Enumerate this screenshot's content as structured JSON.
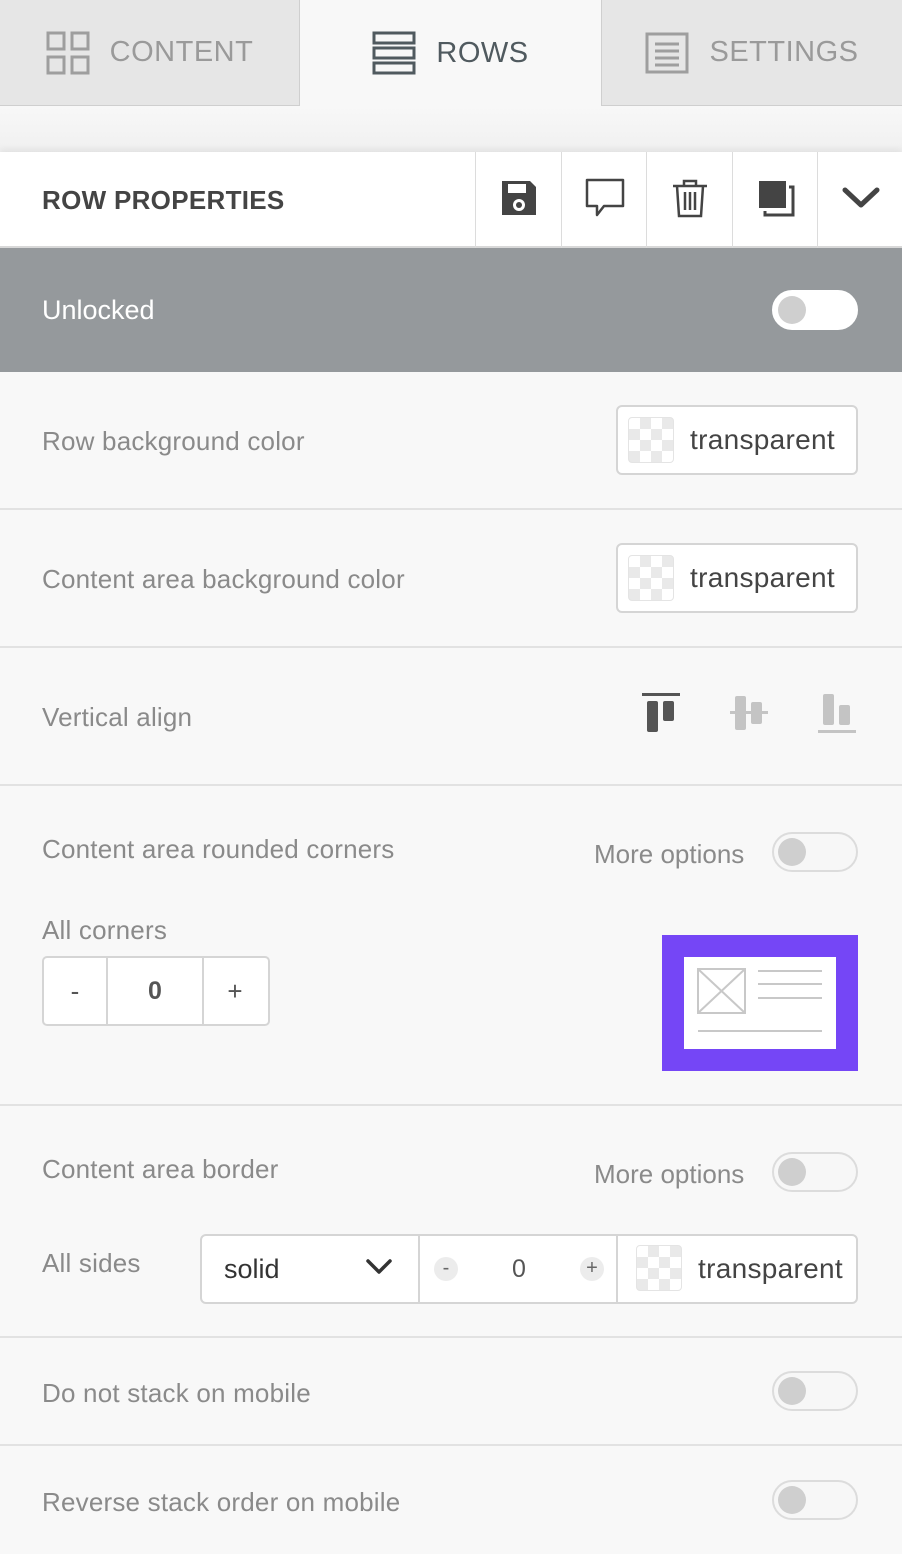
{
  "tabs": [
    {
      "label": "CONTENT",
      "icon": "grid-icon"
    },
    {
      "label": "ROWS",
      "icon": "rows-icon"
    },
    {
      "label": "SETTINGS",
      "icon": "settings-doc-icon"
    }
  ],
  "toolbar": {
    "title": "ROW PROPERTIES",
    "actions": [
      "save-icon",
      "comment-icon",
      "trash-icon",
      "duplicate-icon",
      "chevron-down-icon"
    ]
  },
  "lock": {
    "label": "Unlocked",
    "on": false
  },
  "row_background": {
    "label": "Row background color",
    "value": "transparent"
  },
  "content_background": {
    "label": "Content area background color",
    "value": "transparent"
  },
  "vertical_align": {
    "label": "Vertical align",
    "options": [
      "align-top-icon",
      "align-middle-icon",
      "align-bottom-icon"
    ],
    "selected": "top"
  },
  "rounded_corners": {
    "label": "Content area rounded corners",
    "more_options": "More options",
    "all_corners_label": "All corners",
    "minus": "-",
    "value": "0",
    "plus": "+",
    "preview_color": "#7546f6"
  },
  "border": {
    "label": "Content area border",
    "more_options": "More options",
    "all_sides_label": "All sides",
    "style": "solid",
    "minus": "-",
    "width": "0",
    "plus": "+",
    "color": "transparent"
  },
  "no_stack": {
    "label": "Do not stack on mobile",
    "on": false
  },
  "reverse_stack": {
    "label": "Reverse stack order on mobile",
    "on": false
  }
}
